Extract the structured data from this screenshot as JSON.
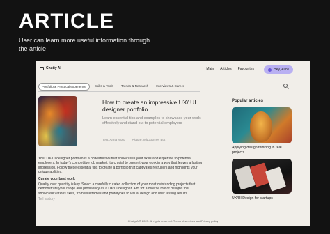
{
  "hero": {
    "title": "ARTICLE",
    "subtitle": "User can learn more useful information through the article"
  },
  "app": {
    "logo_text": "Chatty AI",
    "nav": [
      "Main",
      "Articles",
      "Favourites"
    ],
    "user_button": "Hey, Alice"
  },
  "tabs": [
    "Portfolio & Practical experience",
    "Skills & Tools",
    "Trends & Research",
    "Interviews & Career"
  ],
  "article": {
    "title": "How to create an impressive UX/ UI designer portfolio",
    "description": "Learn essential tips and examples to showcase your work effectively and stand out to potential employers",
    "meta_text": "Text: Anna Moro",
    "meta_picture": "Picture: MidJourney Bot",
    "intro": "Your UX/UI designer portfolio is a powerful tool that showcases your skills and expertise to potential employers. In today's competitive job market, it's crucial to present your work in a way that leaves a lasting impression. Follow these essential tips to create a portfolio that captivates recruiters and highlights your unique abilities:",
    "section_heading": "Curate your best work",
    "section_body": "Quality over quantity is key. Select a carefully curated collection of your most outstanding projects that demonstrate your range and proficiency as a UX/UI designer. Aim for a diverse mix of designs that showcase various skills, from wireframes and prototypes to visual design and user testing results.",
    "story_link": "Tell a story"
  },
  "sidebar": {
    "title": "Popular articles",
    "items": [
      {
        "caption": "Applying design thinking in real projects"
      },
      {
        "caption": "UX/UI Design for startups"
      }
    ]
  },
  "footer": "Chatty AI® 2023. All rights reserved. Terms of services and Privacy policy",
  "colors": {
    "background": "#121212",
    "frame": "#f1eee9",
    "accent": "#b9b0f2"
  },
  "icons": [
    "logo-icon",
    "search-icon",
    "user-avatar-icon"
  ]
}
